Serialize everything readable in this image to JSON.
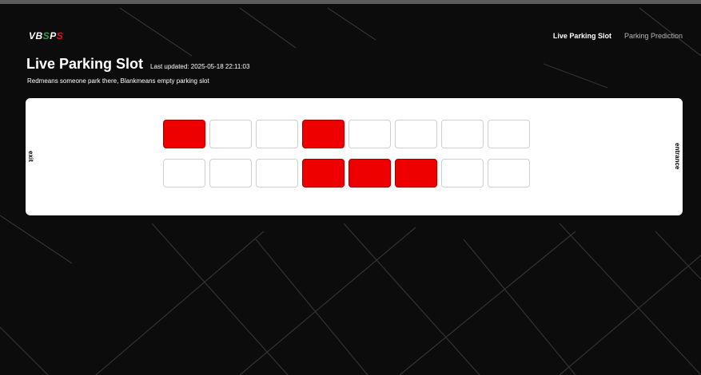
{
  "logo": {
    "part1": "VB",
    "part2": "S",
    "part3": "P",
    "part4": "S"
  },
  "nav": {
    "live": "Live Parking Slot",
    "prediction": "Parking Prediction"
  },
  "header": {
    "title": "Live Parking Slot",
    "updated": "Last updated: 2025-05-18 22:11:03",
    "legend": "Redmeans someone park there, Blankmeans empty parking slot"
  },
  "lot": {
    "exit_label": "exit",
    "entrance_label": "entrance",
    "rows": [
      [
        true,
        false,
        false,
        true,
        false,
        false,
        false,
        false
      ],
      [
        false,
        false,
        false,
        true,
        true,
        true,
        false,
        false
      ]
    ]
  },
  "colors": {
    "occupied": "#ee0000",
    "empty": "#ffffff",
    "background": "#0c0c0c"
  }
}
